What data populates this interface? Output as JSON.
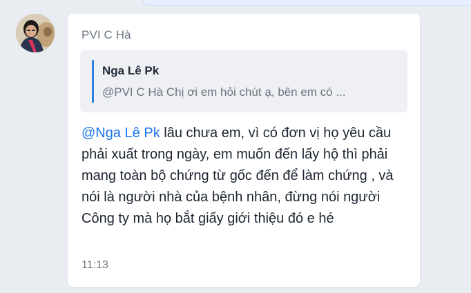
{
  "message": {
    "sender_name": "PVI C Hà",
    "avatar_icon": "user-photo-avatar",
    "reply_quote": {
      "author": "Nga Lê Pk",
      "text": "@PVI C Hà Chị ơi em hỏi chút ạ, bên em có ..."
    },
    "mention": "@Nga Lê Pk",
    "body": " lâu chưa em, vì có đơn vị họ yêu cầu phải xuất trong ngày, em muốn đến lấy hộ thì phải mang toàn bộ chứng từ gốc đến để làm chứng , và nói là người nhà của bệnh nhân, đừng nói người Công ty mà họ bắt giấy giới thiệu đó e hé",
    "time": "11:13"
  },
  "colors": {
    "background": "#e9edf2",
    "bubble": "#ffffff",
    "mention": "#1a73e8",
    "quote_bar": "#2e7de0",
    "muted_text": "#6b7581"
  }
}
